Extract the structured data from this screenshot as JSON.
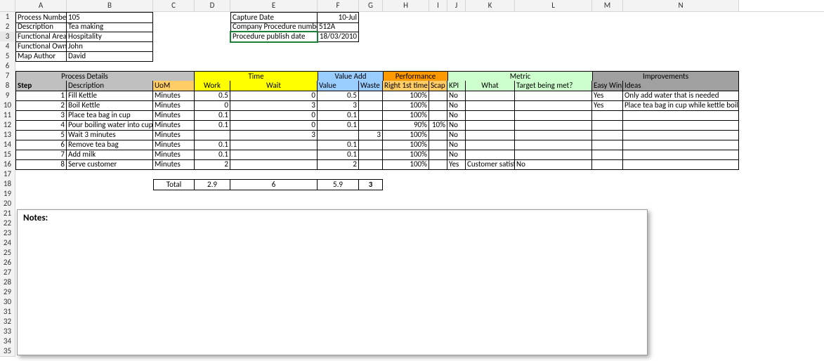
{
  "columns": [
    "A",
    "B",
    "C",
    "D",
    "E",
    "F",
    "G",
    "H",
    "I",
    "J",
    "K",
    "L",
    "M",
    "N"
  ],
  "rows": 35,
  "meta": {
    "process_number_label": "Process  Number",
    "process_number": "105",
    "description_label": "Description",
    "description": "Tea making",
    "functional_area_label": "Functional Area",
    "functional_area": "Hospitality",
    "functional_owner_label": "Functional Owner",
    "functional_owner": "John",
    "map_author_label": "Map Author",
    "map_author": "David",
    "capture_date_label": "Capture Date",
    "capture_date": "10-Jul",
    "company_proc_label": "Company Procedure number",
    "company_proc": "512A",
    "pub_date_label": "Procedure publish date",
    "pub_date": "18/03/2010"
  },
  "group_headers": {
    "process_details": "Process Details",
    "time": "Time",
    "value_add": "Value Add",
    "performance": "Performance",
    "metric": "Metric",
    "improvements": "Improvements"
  },
  "col_headers": {
    "step": "Step",
    "description": "Description",
    "uom": "UoM",
    "work": "Work",
    "wait": "Wait",
    "value": "Value",
    "waste": "Waste",
    "right1st": "Right 1st time",
    "scap": "Scap %",
    "kpi": "KPI",
    "what": "What",
    "target_met": "Target being met?",
    "easy_win": "Easy Win",
    "ideas": "Ideas"
  },
  "data": [
    {
      "step": "1",
      "desc": "Fill Kettle",
      "uom": "Minutes",
      "work": "0.5",
      "wait": "0",
      "value": "0.5",
      "waste": "",
      "right": "100%",
      "scap": "",
      "kpi": "No",
      "what": "",
      "target": "",
      "easy": "Yes",
      "ideas": "Only add water that is needed"
    },
    {
      "step": "2",
      "desc": "Boil Kettle",
      "uom": "Minutes",
      "work": "0",
      "wait": "3",
      "value": "3",
      "waste": "",
      "right": "100%",
      "scap": "",
      "kpi": "No",
      "what": "",
      "target": "",
      "easy": "Yes",
      "ideas": "Place tea bag in cup while kettle boils"
    },
    {
      "step": "3",
      "desc": "Place tea bag in cup",
      "uom": "Minutes",
      "work": "0.1",
      "wait": "0",
      "value": "0.1",
      "waste": "",
      "right": "100%",
      "scap": "",
      "kpi": "No",
      "what": "",
      "target": "",
      "easy": "",
      "ideas": ""
    },
    {
      "step": "4",
      "desc": "Pour boiling water into cup",
      "uom": "Minutes",
      "work": "0.1",
      "wait": "0",
      "value": "0.1",
      "waste": "",
      "right": "90%",
      "scap": "10%",
      "kpi": "No",
      "what": "",
      "target": "",
      "easy": "",
      "ideas": ""
    },
    {
      "step": "5",
      "desc": "Wait 3 minutes",
      "uom": "Minutes",
      "work": "",
      "wait": "3",
      "value": "",
      "waste": "3",
      "right": "100%",
      "scap": "",
      "kpi": "No",
      "what": "",
      "target": "",
      "easy": "",
      "ideas": ""
    },
    {
      "step": "6",
      "desc": "Remove tea bag",
      "uom": "Minutes",
      "work": "0.1",
      "wait": "",
      "value": "0.1",
      "waste": "",
      "right": "100%",
      "scap": "",
      "kpi": "No",
      "what": "",
      "target": "",
      "easy": "",
      "ideas": ""
    },
    {
      "step": "7",
      "desc": "Add milk",
      "uom": "Minutes",
      "work": "0.1",
      "wait": "",
      "value": "0.1",
      "waste": "",
      "right": "100%",
      "scap": "",
      "kpi": "No",
      "what": "",
      "target": "",
      "easy": "",
      "ideas": ""
    },
    {
      "step": "8",
      "desc": "Serve customer",
      "uom": "Minutes",
      "work": "2",
      "wait": "",
      "value": "2",
      "waste": "",
      "right": "100%",
      "scap": "",
      "kpi": "Yes",
      "what": "Customer satisfaction",
      "target": "No",
      "easy": "",
      "ideas": ""
    }
  ],
  "totals": {
    "label": "Total",
    "work": "2.9",
    "wait": "6",
    "value": "5.9",
    "waste": "3"
  },
  "notes_label": "Notes:"
}
